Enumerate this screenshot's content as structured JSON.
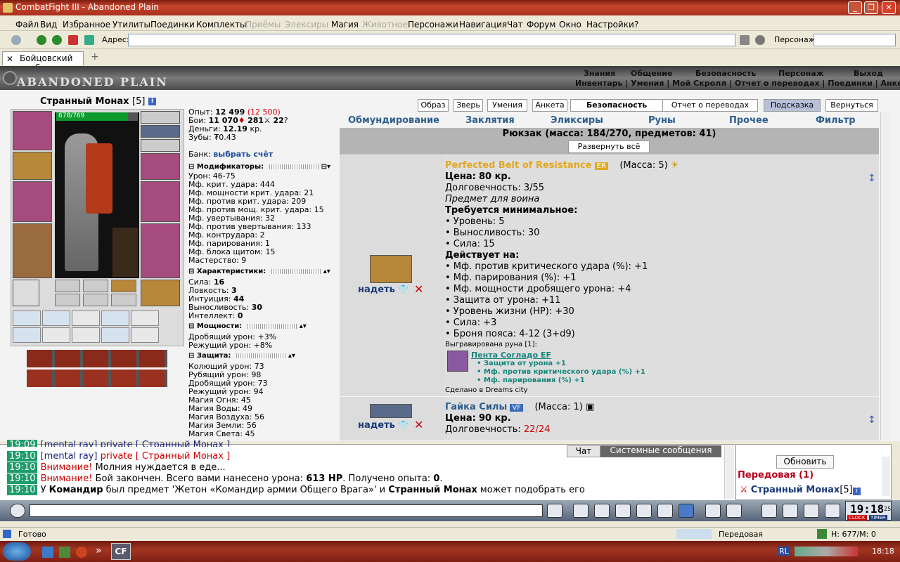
{
  "window": {
    "title": "CombatFight III - Abandoned Plain"
  },
  "menu": [
    "Файл",
    "Вид",
    "Избранное",
    "Утилиты",
    "Поединки",
    "Комплекты",
    "Приёмы",
    "Элексиры",
    "Магия",
    "Животное",
    "Персонажи",
    "Навигация",
    "Чат",
    "Форум",
    "Окно",
    "Настройки",
    "?"
  ],
  "menu_disabled": [
    "Приёмы",
    "Элексиры",
    "Животное"
  ],
  "address": {
    "label": "Адрес:",
    "value": "",
    "char_label": "Персонаж:",
    "char_value": ""
  },
  "tab": {
    "label": "Бойцовский клуб"
  },
  "logo": "ABANDONED PLAIN",
  "nav_top": [
    "Знания",
    "Общение",
    "Безопасность",
    "Персонаж",
    "Выход"
  ],
  "nav_bottom": "Инвентарь | Умения | Мой Скролл | Отчет о переводах | Поединки | Анкета",
  "character": {
    "name": "Странный Монах",
    "level": "[5]",
    "hp": "678/769",
    "hp_fraction": 0.88
  },
  "stats": {
    "exp_label": "Опыт:",
    "exp": "12 499",
    "exp_next": "(12 500)",
    "fights_label": "Бои:",
    "wins": "11 070",
    "losses": "281",
    "draws": "22",
    "money_label": "Деньги:",
    "money": "12.19",
    "money_unit": "кр.",
    "teeth_label": "Зубы:",
    "teeth": "0.43",
    "bank_label": "Банк:",
    "bank_link": "выбрать счёт"
  },
  "modifiers": {
    "title": "Модификаторы:",
    "lines": [
      "Урон: 46-75",
      "Мф. крит. удара: 444",
      "Мф. мощности крит. удара: 21",
      "Мф. против крит. удара: 209",
      "Мф. против мощ. крит. удара: 15",
      "Мф. увертывания: 32",
      "Мф. против увертывания: 133",
      "Мф. контрудара: 2",
      "Мф. парирования: 1",
      "Мф. блока щитом: 15",
      "Мастерство: 9"
    ]
  },
  "characteristics": {
    "title": "Характеристики:",
    "lines": [
      {
        "k": "Сила:",
        "v": "16"
      },
      {
        "k": "Ловкость:",
        "v": "3"
      },
      {
        "k": "Интуиция:",
        "v": "44"
      },
      {
        "k": "Выносливость:",
        "v": "30"
      },
      {
        "k": "Интеллект:",
        "v": "0"
      }
    ]
  },
  "power": {
    "title": "Мощности:",
    "lines": [
      "Дробящий урон: +3%",
      "Режущий урон: +8%"
    ]
  },
  "defense": {
    "title": "Защита:",
    "lines": [
      "Колющий урон: 73",
      "Рубящий урон: 98",
      "Дробящий урон: 73",
      "Режущий урон: 94",
      "Магия Огня: 45",
      "Магия Воды: 49",
      "Магия Воздуха: 56",
      "Магия Земли: 56",
      "Магия Света: 45"
    ]
  },
  "top_buttons": [
    "Образ",
    "Зверь",
    "Умения",
    "Анкета",
    "Безопасность",
    "Отчет о переводах",
    "Подсказка",
    "Вернуться"
  ],
  "categories": [
    "Обмундирование",
    "Заклятия",
    "Эликсиры",
    "Руны",
    "Прочее",
    "Фильтр"
  ],
  "backpack": {
    "title": "Рюкзак (масса: 184/270, предметов: 41)",
    "expand": "Развернуть всё"
  },
  "item1": {
    "name": "Perfected Belt of Resistance",
    "badge": "ER",
    "mass": "(Масса: 5)",
    "price_label": "Цена:",
    "price": "80 кр.",
    "durability": "Долговечность: 3/55",
    "class": "Предмет для воина",
    "req_title": "Требуется минимальное:",
    "reqs": [
      "• Уровень: 5",
      "• Выносливость: 30",
      "• Сила: 15"
    ],
    "acts_title": "Действует на:",
    "acts": [
      "• Мф. против критического удара (%): +1",
      "• Мф. парирования (%): +1",
      "• Мф. мощности дробящего урона: +4",
      "• Защита от урона: +11",
      "• Уровень жизни (HP): +30",
      "• Сила: +3",
      "• Броня пояса: 4-12 (3+d9)"
    ],
    "rune_label": "Выгравирована руна [1]:",
    "rune_name": "Пента Согладо EF",
    "rune_lines": [
      "• Защита от урона +1",
      "• Мф. против критического удара (%) +1",
      "• Мф. парирования (%) +1"
    ],
    "made": "Сделано в Dreams city",
    "wear": "надеть"
  },
  "item2": {
    "name": "Гайка Силы",
    "badge": "VF",
    "mass": "(Масса: 1)",
    "price_label": "Цена:",
    "price": "90 кр.",
    "durability_label": "Долговечность:",
    "durability": "22/24",
    "wear": "надеть"
  },
  "chat_tabs": [
    "Чат",
    "Системные сообщения"
  ],
  "chat_lines": [
    {
      "time": "19:10",
      "html_parts": [
        [
          "[mental ray] ",
          "#1a237e"
        ],
        [
          "private [ Странный Монах ]",
          "#d00000"
        ]
      ]
    },
    {
      "time": "19:10",
      "html_parts": [
        [
          "Внимание! ",
          "#d00000"
        ],
        [
          "Молния нуждается в еде...",
          "#000"
        ]
      ]
    },
    {
      "time": "19:10",
      "html_parts": [
        [
          "Внимание! ",
          "#d00000"
        ],
        [
          "Бой закончен. Всего вами нанесено урона: ",
          "#000"
        ],
        [
          "613 HP",
          "#000",
          "b"
        ],
        [
          ". Получено опыта: ",
          "#000"
        ],
        [
          "0",
          "#000",
          "b"
        ],
        [
          ".",
          "#000"
        ]
      ]
    },
    {
      "time": "19:10",
      "html_parts": [
        [
          "У ",
          "#000"
        ],
        [
          "Командир",
          "#000",
          "b"
        ],
        [
          " был предмет 'Жетон «Командир армии Общего Врага»' и ",
          "#000"
        ],
        [
          "Странный Монах",
          "#000",
          "b"
        ],
        [
          " может подобрать его",
          "#000"
        ]
      ]
    }
  ],
  "chat_top_partial": "[mental ray] private [ Странный Монах ]",
  "right_panel": {
    "refresh": "Обновить",
    "location": "Передовая (1)",
    "player": "Странный Монах",
    "player_level": "[5]"
  },
  "clock": {
    "time": "19:18",
    "sec": "25",
    "clock_label": "CLOCK",
    "timer_label": "TIMER"
  },
  "status": {
    "ready": "Готово",
    "zone": "Передовая",
    "hm": "H: 677/M: 0"
  },
  "taskbar": {
    "lang": "RL",
    "time": "18:18",
    "app": "CF"
  }
}
